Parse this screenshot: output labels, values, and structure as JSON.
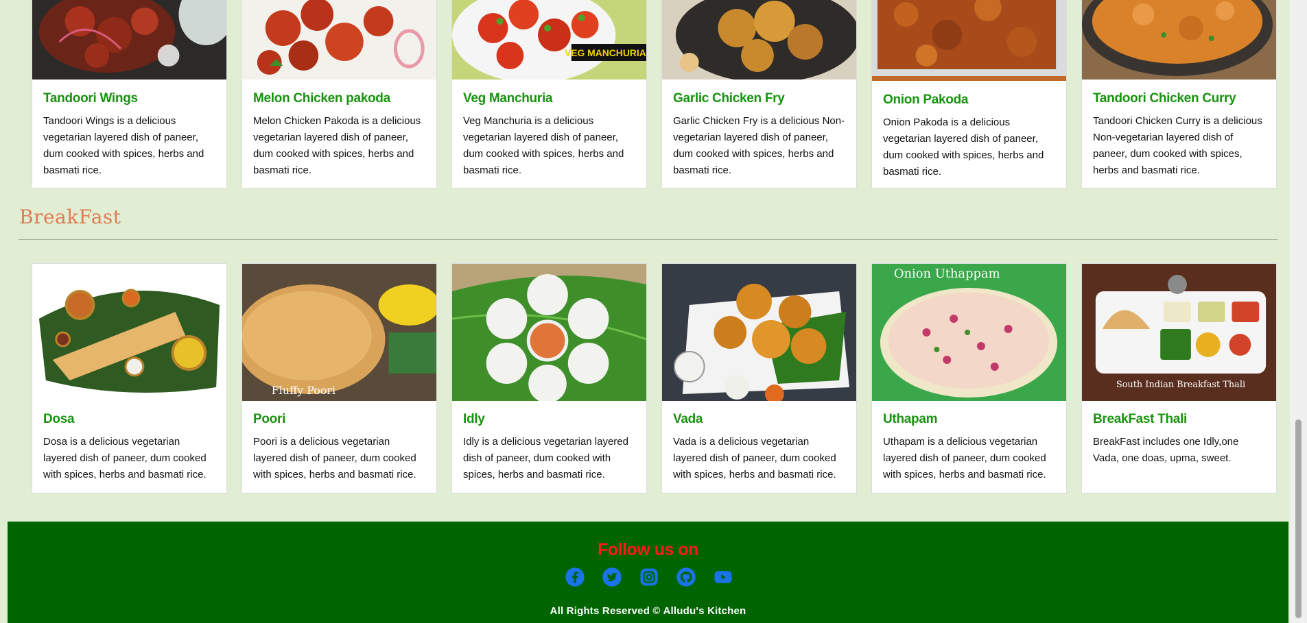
{
  "top_cards": [
    {
      "title": "Tandoori Wings",
      "text": "Tandoori Wings is a delicious vegetarian layered dish of paneer, dum cooked with spices, herbs and basmati rice."
    },
    {
      "title": "Melon Chicken pakoda",
      "text": "Melon Chicken Pakoda is a delicious vegetarian layered dish of paneer, dum cooked with spices, herbs and basmati rice."
    },
    {
      "title": "Veg Manchuria",
      "text": "Veg Manchuria is a delicious vegetarian layered dish of paneer, dum cooked with spices, herbs and basmati rice.",
      "image_caption": "VEG MANCHURIAN"
    },
    {
      "title": "Garlic Chicken Fry",
      "text": "Garlic Chicken Fry is a delicious Non-vegetarian layered dish of paneer, dum cooked with spices, herbs and basmati rice."
    },
    {
      "title": "Onion Pakoda",
      "text": "Onion Pakoda is a delicious vegetarian layered dish of paneer, dum cooked with spices, herbs and basmati rice."
    },
    {
      "title": "Tandoori Chicken Curry",
      "text": "Tandoori Chicken Curry is a delicious Non-vegetarian layered dish of paneer, dum cooked with spices, herbs and basmati rice."
    }
  ],
  "section": {
    "title": "BreakFast"
  },
  "breakfast_cards": [
    {
      "title": "Dosa",
      "text": "Dosa is a delicious vegetarian layered dish of paneer, dum cooked with spices, herbs and basmati rice."
    },
    {
      "title": "Poori",
      "text": "Poori is a delicious vegetarian layered dish of paneer, dum cooked with spices, herbs and basmati rice.",
      "image_caption": "Fluffy Poori"
    },
    {
      "title": "Idly",
      "text": "Idly is a delicious vegetarian layered dish of paneer, dum cooked with spices, herbs and basmati rice."
    },
    {
      "title": "Vada",
      "text": "Vada is a delicious vegetarian layered dish of paneer, dum cooked with spices, herbs and basmati rice."
    },
    {
      "title": "Uthapam",
      "text": "Uthapam is a delicious vegetarian layered dish of paneer, dum cooked with spices, herbs and basmati rice.",
      "image_caption": "Onion Uthappam"
    },
    {
      "title": "BreakFast Thali",
      "text": "BreakFast includes one Idly,one Vada, one doas, upma, sweet.",
      "image_caption": "South Indian Breakfast Thali"
    }
  ],
  "footer": {
    "follow": "Follow us on",
    "copyright": "All Rights Reserved © Alludu's Kitchen",
    "icons": [
      "facebook-icon",
      "twitter-icon",
      "instagram-icon",
      "github-icon",
      "youtube-icon"
    ],
    "icon_color": "#1a73e8",
    "background": "#006400",
    "follow_color": "#ff1a1a"
  },
  "colors": {
    "page_bg": "#e1eed3",
    "title_green": "#17930e",
    "section_orange": "#e07b54"
  }
}
